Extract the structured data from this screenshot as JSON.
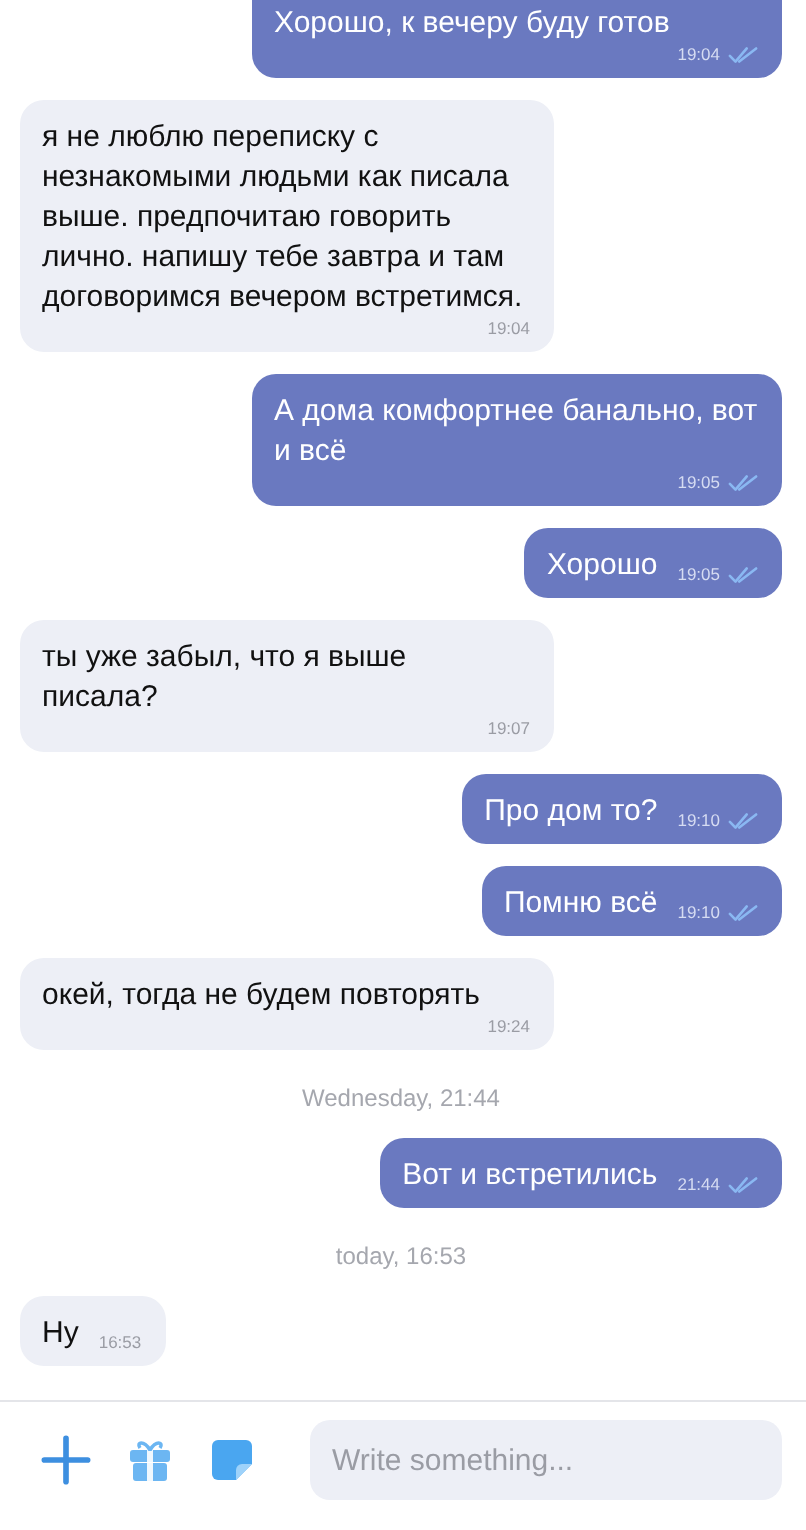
{
  "messages": [
    {
      "kind": "out",
      "text": "Хорошо, к вечеру буду готов",
      "time": "19:04",
      "read": true
    },
    {
      "kind": "in",
      "text": "я не люблю переписку с незнакомыми людьми как писала выше. предпочитаю говорить лично. напишу тебе завтра и там договоримся вечером встретимся.",
      "time": "19:04"
    },
    {
      "kind": "out",
      "text": "А дома комфортнее банально, вот и всё",
      "time": "19:05",
      "read": true
    },
    {
      "kind": "out",
      "text": "Хорошо",
      "time": "19:05",
      "read": true
    },
    {
      "kind": "in",
      "text": "ты уже забыл, что я выше писала?",
      "time": "19:07"
    },
    {
      "kind": "out",
      "text": "Про дом то?",
      "time": "19:10",
      "read": true
    },
    {
      "kind": "out",
      "text": "Помню всё",
      "time": "19:10",
      "read": true
    },
    {
      "kind": "in",
      "text": "окей, тогда не будем повторять",
      "time": "19:24"
    },
    {
      "kind": "date",
      "text": "Wednesday, 21:44"
    },
    {
      "kind": "out",
      "text": "Вот и встретились",
      "time": "21:44",
      "read": true
    },
    {
      "kind": "date",
      "text": "today, 16:53"
    },
    {
      "kind": "in",
      "text": "Ну",
      "time": "16:53"
    }
  ],
  "composer": {
    "placeholder": "Write something..."
  }
}
